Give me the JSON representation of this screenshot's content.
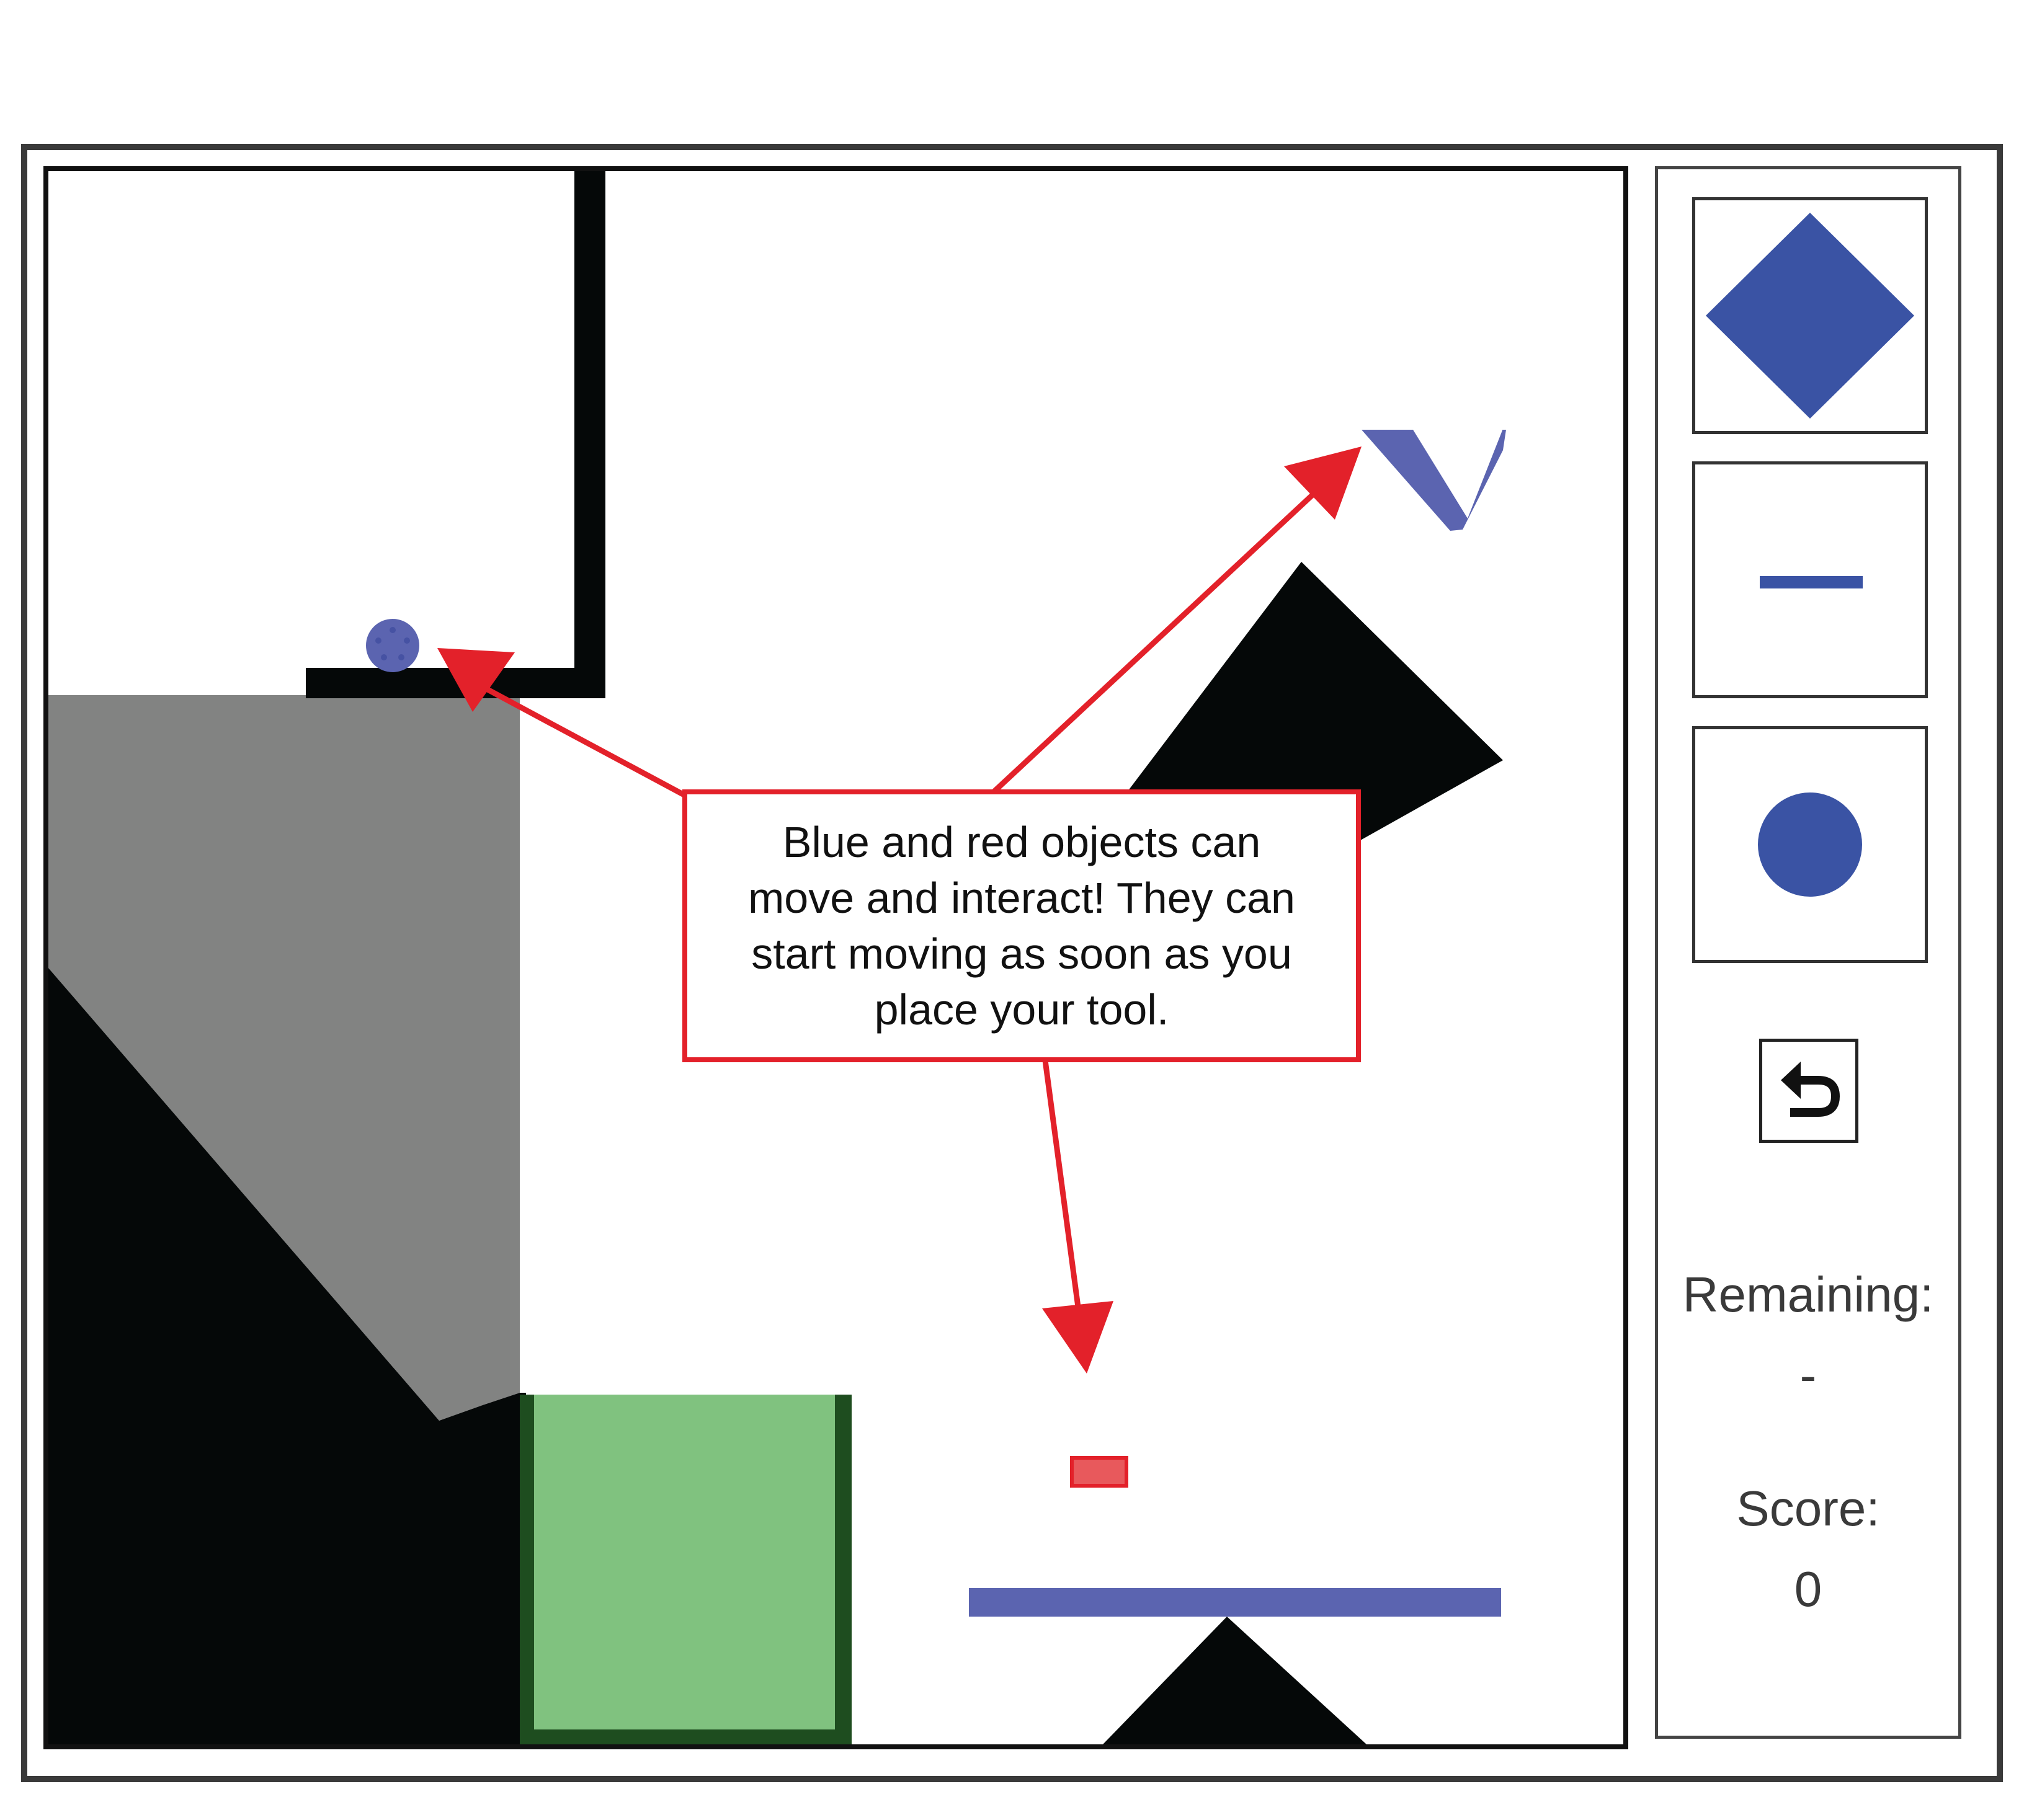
{
  "callout": {
    "text": "Blue and red objects can\nmove and interact! They can\nstart moving as soon as you\nplace your tool."
  },
  "side_panel": {
    "tools": [
      {
        "name": "diamond-tool",
        "shape": "diamond",
        "color": "#3a53a4"
      },
      {
        "name": "line-tool",
        "shape": "line",
        "color": "#3a53a4"
      },
      {
        "name": "circle-tool",
        "shape": "circle",
        "color": "#3a53a4"
      }
    ],
    "reset_icon": "reset-arrow-icon",
    "remaining_label": "Remaining:",
    "remaining_value": "-",
    "score_label": "Score:",
    "score_value": "0"
  },
  "colors": {
    "dynamic_blue": "#5b64b0",
    "tool_blue": "#3a53a4",
    "dynamic_red": "#e8595c",
    "goal_green": "#80c27f",
    "goal_border": "#1e4d1f",
    "static_black": "#050808",
    "gray_region": "#828382",
    "callout_red": "#e3212a"
  }
}
